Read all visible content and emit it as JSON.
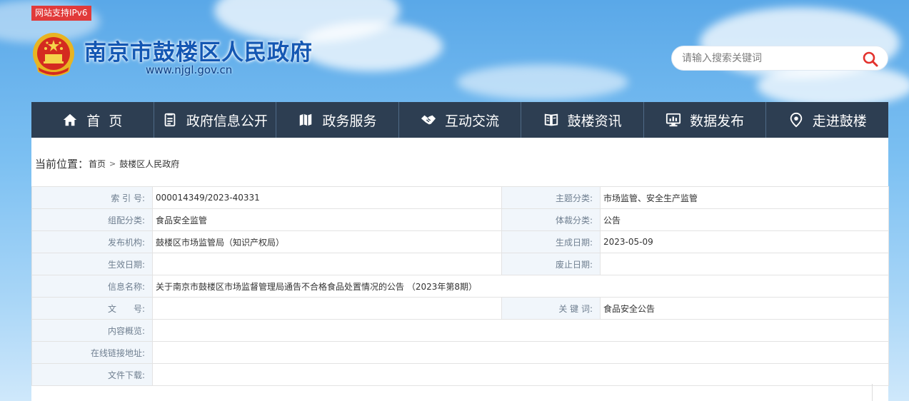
{
  "header": {
    "ipv6_badge": "网站支持IPv6",
    "site_title": "南京市鼓楼区人民政府",
    "site_url": "www.njgl.gov.cn",
    "search_placeholder": "请输入搜索关键词"
  },
  "nav": {
    "items": [
      {
        "label": "首  页",
        "icon": "home-icon"
      },
      {
        "label": "政府信息公开",
        "icon": "document-icon"
      },
      {
        "label": "政务服务",
        "icon": "map-icon"
      },
      {
        "label": "互动交流",
        "icon": "handshake-icon"
      },
      {
        "label": "鼓楼资讯",
        "icon": "book-icon"
      },
      {
        "label": "数据发布",
        "icon": "monitor-chart-icon"
      },
      {
        "label": "走进鼓楼",
        "icon": "location-pin-icon"
      }
    ]
  },
  "breadcrumb": {
    "prefix": "当前位置：",
    "home": "首页",
    "separator": ">",
    "current": "鼓楼区人民政府"
  },
  "info": {
    "index_no_label": "索 引 号:",
    "index_no": "000014349/2023-40331",
    "theme_label": "主题分类:",
    "theme": "市场监管、安全生产监管",
    "category_label": "组配分类:",
    "category": "食品安全监管",
    "genre_label": "体裁分类:",
    "genre": "公告",
    "issuer_label": "发布机构:",
    "issuer": "鼓楼区市场监管局（知识产权局）",
    "created_label": "生成日期:",
    "created": "2023-05-09",
    "effective_label": "生效日期:",
    "effective": "",
    "expired_label": "废止日期:",
    "expired": "",
    "name_label": "信息名称:",
    "name": "关于南京市鼓楼区市场监督管理局通告不合格食品处置情况的公告 （2023年第8期）",
    "doc_no_label": "文　　号:",
    "doc_no": "",
    "keywords_label": "关 键 词:",
    "keywords": "食品安全公告",
    "summary_label": "内容概览:",
    "summary": "",
    "link_label": "在线链接地址:",
    "link": "",
    "download_label": "文件下载:",
    "download": ""
  },
  "colors": {
    "nav_bg": "#2d3e52",
    "title_blue": "#1457b3",
    "badge_red": "#e13a3a",
    "label_bg": "#f1f6fb"
  }
}
